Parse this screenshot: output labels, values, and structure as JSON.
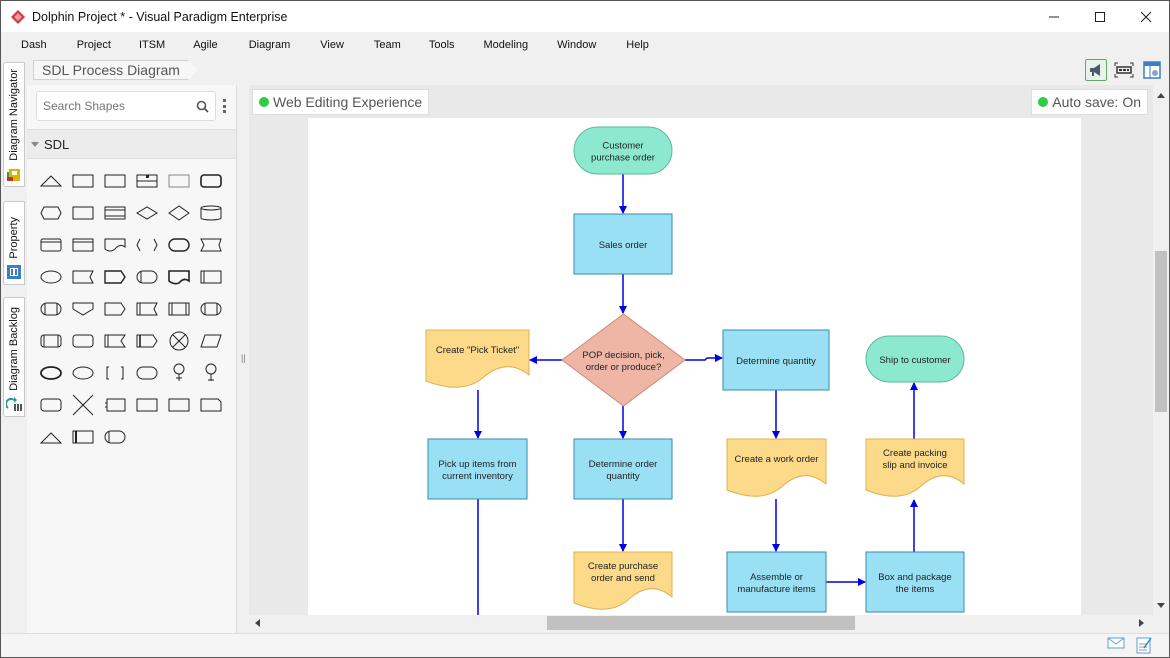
{
  "window": {
    "title": "Dolphin Project * - Visual Paradigm Enterprise",
    "controls": [
      "minimize",
      "maximize",
      "close"
    ]
  },
  "menu": [
    "Dash",
    "Project",
    "ITSM",
    "Agile",
    "Diagram",
    "View",
    "Team",
    "Tools",
    "Modeling",
    "Window",
    "Help"
  ],
  "left_tabs": [
    {
      "label": "Diagram Navigator",
      "icon": "diagram-navigator-icon"
    },
    {
      "label": "Property",
      "icon": "property-icon"
    },
    {
      "label": "Diagram Backlog",
      "icon": "diagram-backlog-icon"
    }
  ],
  "breadcrumb": "SDL Process Diagram",
  "toolbar_icons": [
    "announcement-icon",
    "fit-page-icon",
    "panel-layout-icon"
  ],
  "palette": {
    "search_placeholder": "Search Shapes",
    "category": "SDL",
    "shape_count": 51
  },
  "badges": {
    "web_editing": "Web Editing Experience",
    "autosave": "Auto save: On",
    "status_color": "#2ecc40"
  },
  "diagram": {
    "nodes": [
      {
        "id": "customer-po",
        "type": "terminal",
        "lines": [
          "Customer",
          "purchase order"
        ]
      },
      {
        "id": "sales-order",
        "type": "process",
        "lines": [
          "Sales order"
        ]
      },
      {
        "id": "pop-decision",
        "type": "decision",
        "lines": [
          "POP decision, pick,",
          "order or produce?"
        ]
      },
      {
        "id": "pick-ticket",
        "type": "document",
        "lines": [
          "Create \"Pick Ticket\""
        ]
      },
      {
        "id": "determine-qty",
        "type": "process",
        "lines": [
          "Determine quantity"
        ]
      },
      {
        "id": "ship",
        "type": "terminal",
        "lines": [
          "Ship to customer"
        ]
      },
      {
        "id": "pick-up",
        "type": "process",
        "lines": [
          "Pick up items from",
          "current inventory"
        ]
      },
      {
        "id": "det-order-qty",
        "type": "process",
        "lines": [
          "Determine order",
          "quantity"
        ]
      },
      {
        "id": "work-order",
        "type": "document",
        "lines": [
          "Create a work order"
        ]
      },
      {
        "id": "packing-slip",
        "type": "document",
        "lines": [
          "Create packing",
          "slip and invoice"
        ]
      },
      {
        "id": "purchase-order",
        "type": "document",
        "lines": [
          "Create purchase",
          "order and send"
        ]
      },
      {
        "id": "assemble",
        "type": "process",
        "lines": [
          "Assemble or",
          "manufacture items"
        ]
      },
      {
        "id": "box",
        "type": "process",
        "lines": [
          "Box and package",
          "the items"
        ]
      }
    ],
    "colors": {
      "terminal": "#8de8d0",
      "process": "#99e0f5",
      "decision": "#efb5a5",
      "document": "#fdd98a",
      "connector": "#0000e0"
    }
  }
}
